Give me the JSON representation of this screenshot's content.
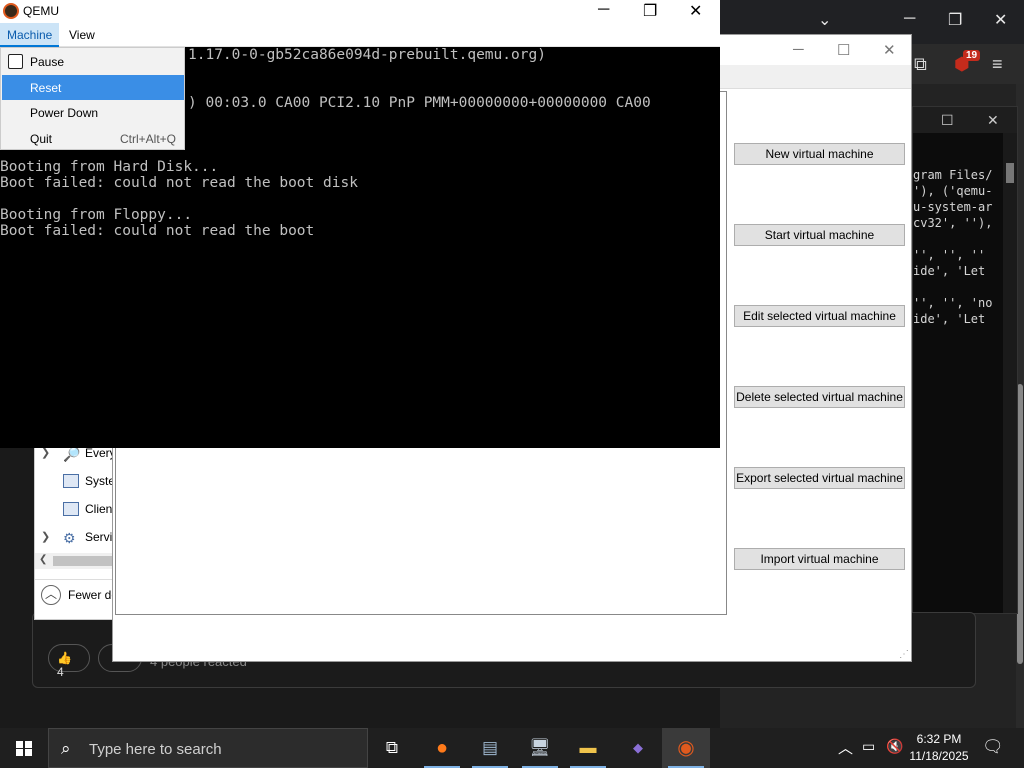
{
  "qemu": {
    "title": "QEMU",
    "menus": [
      "Machine",
      "View"
    ],
    "machine_menu": {
      "pause": "Pause",
      "reset": "Reset",
      "power_down": "Power Down",
      "quit": "Quit",
      "quit_shortcut": "Ctrl+Alt+Q"
    },
    "screen_lines": [
      "1.17.0-0-gb52ca86e094d-prebuilt.qemu.org)",
      ") 00:03.0 CA00 PCI2.10 PnP PMM+00000000+00000000 CA00",
      "Booting from Hard Disk...",
      "Boot failed: could not read the boot disk",
      "Booting from Floppy...",
      "Boot failed: could not read the boot"
    ]
  },
  "vm_manager": {
    "buttons": {
      "new": "New virtual machine",
      "start": "Start virtual machine",
      "edit": "Edit selected virtual machine",
      "delete": "Delete selected virtual machine",
      "export": "Export selected virtual machine",
      "import": "Import virtual machine"
    }
  },
  "explorer": {
    "items": [
      "Every",
      "Syste",
      "Clien",
      "Servi"
    ],
    "fewer": "Fewer de"
  },
  "console": {
    "lines": [
      "gram Files/",
      "'), ('qemu-",
      "u-system-ar",
      "cv32', ''),",
      "",
      "'', '', ''",
      "ide', 'Let",
      "",
      "'', '', 'no",
      "ide', 'Let"
    ]
  },
  "browser": {
    "badge": "19"
  },
  "post": {
    "likes": "4",
    "reacted": "4 people reacted"
  },
  "taskbar": {
    "search_placeholder": "Type here to search",
    "time": "6:32 PM",
    "date": "11/18/2025"
  },
  "colors": {
    "menu_highlight": "#3a8ee6",
    "taskbar": "#1f1f1f",
    "terminal_text": "#c0c0c0"
  }
}
